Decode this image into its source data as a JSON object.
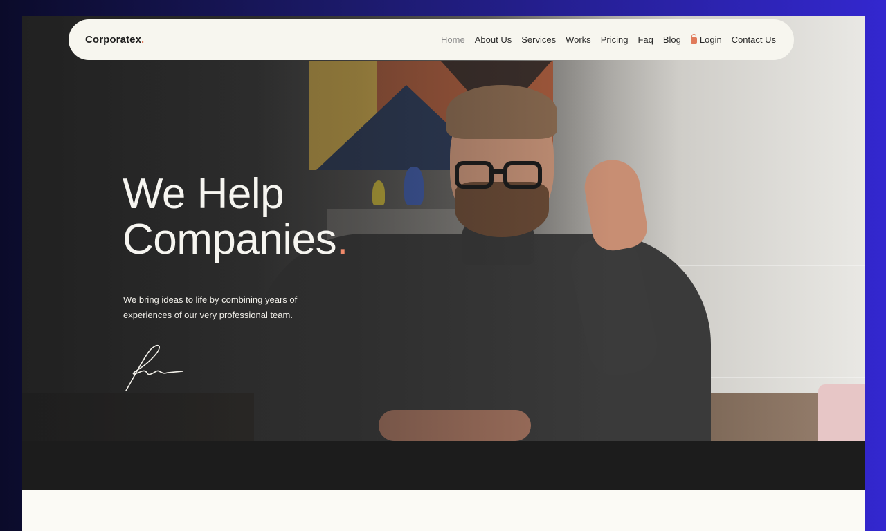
{
  "nav": {
    "logo": "Corporatex",
    "logo_dot": ".",
    "links": [
      {
        "label": "Home",
        "active": true
      },
      {
        "label": "About Us"
      },
      {
        "label": "Services"
      },
      {
        "label": "Works"
      },
      {
        "label": "Pricing"
      },
      {
        "label": "Faq"
      },
      {
        "label": "Blog"
      },
      {
        "label": "Login",
        "icon": "lock-icon"
      },
      {
        "label": "Contact Us"
      }
    ]
  },
  "hero": {
    "title_line1": "We Help",
    "title_line2": "Companies",
    "title_dot": ".",
    "subtitle_line1": "We bring ideas to life by combining years of",
    "subtitle_line2": "experiences of our very professional team."
  },
  "colors": {
    "accent": "#e0785a",
    "page_background": "#3327cf",
    "band": "#1c1c1c"
  }
}
